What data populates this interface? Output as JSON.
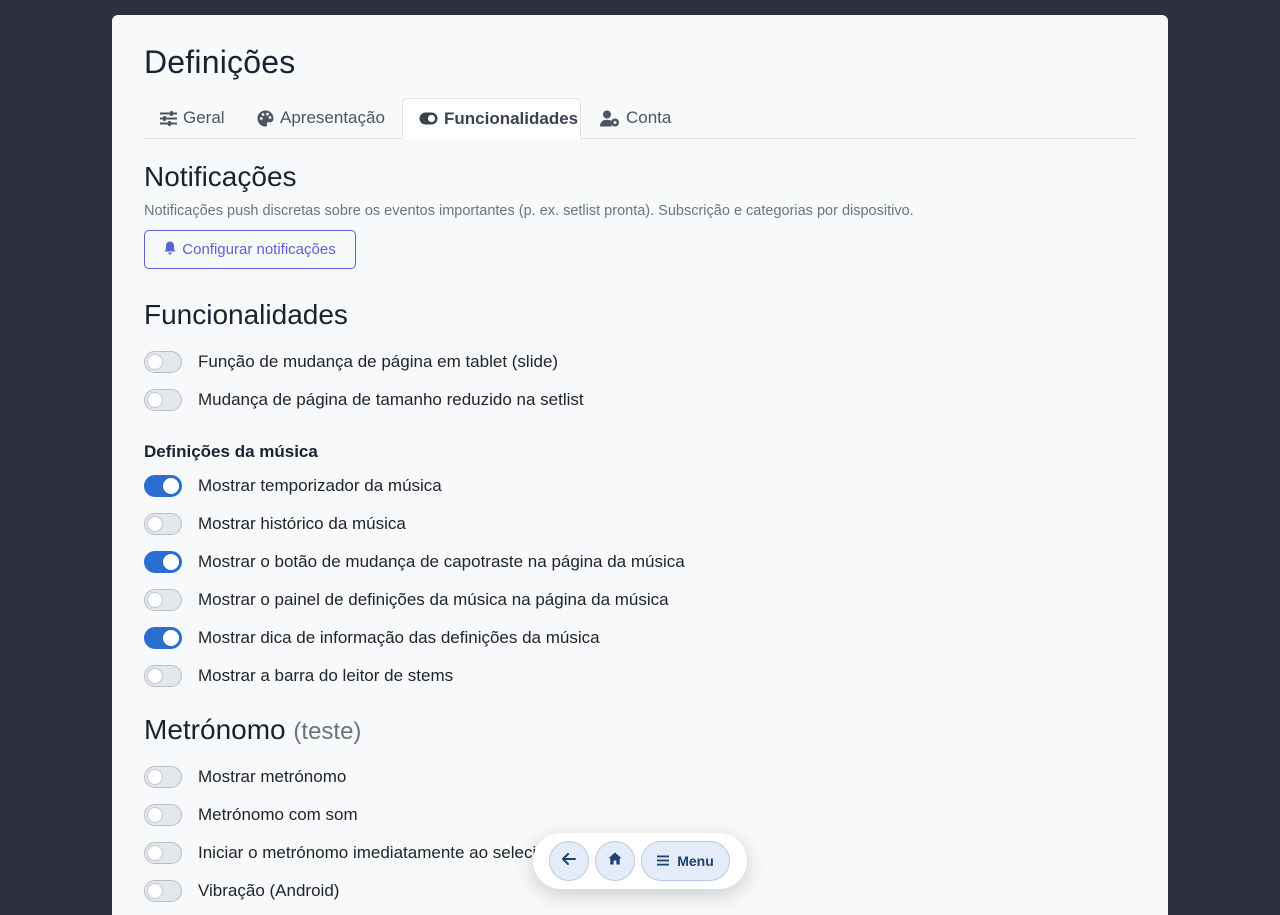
{
  "page": {
    "title": "Definições"
  },
  "tabs": [
    {
      "label": "Geral",
      "icon": "sliders-icon",
      "active": false
    },
    {
      "label": "Apresentação",
      "icon": "palette-icon",
      "active": false
    },
    {
      "label": "Funcionalidades",
      "icon": "toggle-icon",
      "active": true
    },
    {
      "label": "Conta",
      "icon": "user-gear-icon",
      "active": false
    }
  ],
  "notifications": {
    "title": "Notificações",
    "description": "Notificações push discretas sobre os eventos importantes (p. ex. setlist pronta). Subscrição e categorias por dispositivo.",
    "button_label": "Configurar notificações",
    "button_icon": "bell-icon"
  },
  "features": {
    "title": "Funcionalidades",
    "toggles": [
      {
        "label": "Função de mudança de página em tablet (slide)",
        "on": false
      },
      {
        "label": "Mudança de página de tamanho reduzido na setlist",
        "on": false
      }
    ]
  },
  "music_settings": {
    "title": "Definições da música",
    "toggles": [
      {
        "label": "Mostrar temporizador da música",
        "on": true
      },
      {
        "label": "Mostrar histórico da música",
        "on": false
      },
      {
        "label": "Mostrar o botão de mudança de capotraste na página da música",
        "on": true
      },
      {
        "label": "Mostrar o painel de definições da música na página da música",
        "on": false
      },
      {
        "label": "Mostrar dica de informação das definições da música",
        "on": true
      },
      {
        "label": "Mostrar a barra do leitor de stems",
        "on": false
      }
    ]
  },
  "metronome": {
    "title": "Metrónomo",
    "title_suffix": "(teste)",
    "toggles": [
      {
        "label": "Mostrar metrónomo",
        "on": false
      },
      {
        "label": "Metrónomo com som",
        "on": false
      },
      {
        "label": "Iniciar o metrónomo imediatamente ao selecionar",
        "on": false
      },
      {
        "label": "Vibração (Android)",
        "on": false
      }
    ]
  },
  "floating_nav": {
    "back_icon": "arrow-left-icon",
    "home_icon": "home-icon",
    "menu_icon": "menu-icon",
    "menu_label": "Menu"
  },
  "colors": {
    "background": "#2d313d",
    "panel": "#f7f9fb",
    "accent": "#2a6fcf",
    "notify_button": "#5a63d6"
  }
}
